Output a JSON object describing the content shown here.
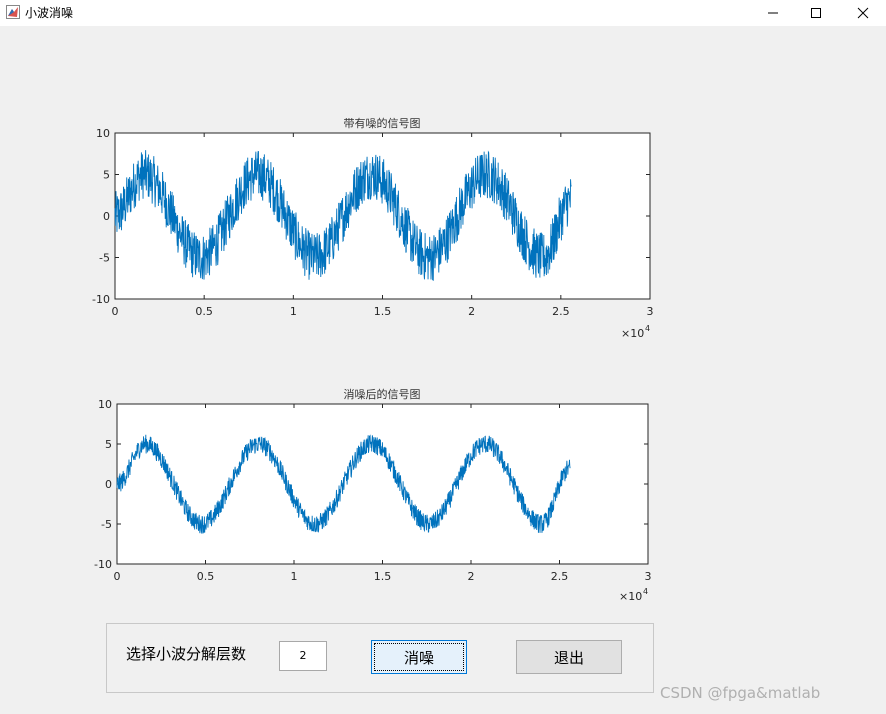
{
  "window": {
    "title": "小波消噪",
    "controls": [
      "minimize",
      "maximize",
      "close"
    ]
  },
  "plots": [
    {
      "title": "带有噪的信号图",
      "x_ticks": [
        "0",
        "0.5",
        "1",
        "1.5",
        "2",
        "2.5",
        "3"
      ],
      "y_ticks": [
        "10",
        "5",
        "0",
        "-5",
        "-10"
      ],
      "x_exponent_base": "×10",
      "x_exponent": "4"
    },
    {
      "title": "消噪后的信号图",
      "x_ticks": [
        "0",
        "0.5",
        "1",
        "1.5",
        "2",
        "2.5",
        "3"
      ],
      "y_ticks": [
        "10",
        "5",
        "0",
        "-5",
        "-10"
      ],
      "x_exponent_base": "×10",
      "x_exponent": "4"
    }
  ],
  "controls": {
    "level_label": "选择小波分解层数",
    "level_value": "2",
    "denoise_label": "消噪",
    "exit_label": "退出"
  },
  "watermark": "CSDN @fpga&matlab",
  "colors": {
    "signal": "#0072bd",
    "background": "#f0f0f0"
  },
  "chart_data": [
    {
      "type": "line",
      "title": "带有噪的信号图",
      "xlabel": "",
      "ylabel": "",
      "x_scale_note": "×10^4",
      "xlim": [
        0,
        30000
      ],
      "ylim": [
        -10,
        10
      ],
      "series": [
        {
          "x": [
            0,
            1600,
            4800,
            8000,
            11200,
            14400,
            17600,
            20800,
            24000,
            25600
          ],
          "y": [
            0,
            5,
            -5,
            5,
            -5,
            5,
            -5,
            5,
            -5,
            2
          ],
          "noise_amplitude": 3
        }
      ]
    },
    {
      "type": "line",
      "title": "消噪后的信号图",
      "xlabel": "",
      "ylabel": "",
      "x_scale_note": "×10^4",
      "xlim": [
        0,
        30000
      ],
      "ylim": [
        -10,
        10
      ],
      "series": [
        {
          "x": [
            0,
            1600,
            4800,
            8000,
            11200,
            14400,
            17600,
            20800,
            24000,
            25600
          ],
          "y": [
            0,
            5,
            -5,
            5,
            -5,
            5,
            -5,
            5,
            -5,
            2
          ],
          "noise_amplitude": 1.2
        }
      ]
    }
  ]
}
